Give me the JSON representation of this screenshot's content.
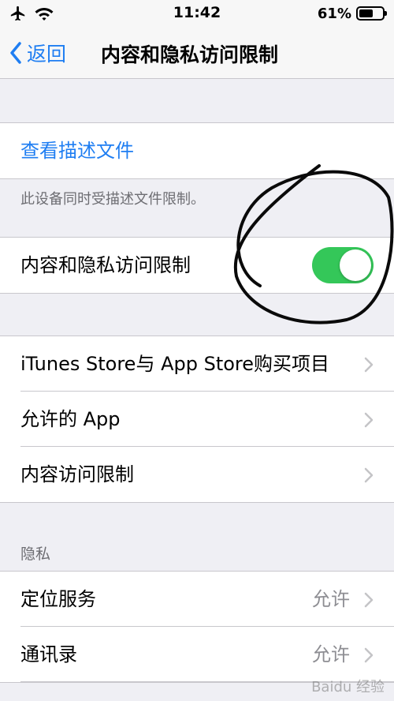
{
  "status_bar": {
    "time": "11:42",
    "battery_percent": "61%",
    "battery_level": 0.61,
    "icons": [
      "airplane-icon",
      "wifi-icon",
      "battery-icon"
    ]
  },
  "nav": {
    "back_label": "返回",
    "title": "内容和隐私访问限制"
  },
  "profile_group": {
    "link_label": "查看描述文件",
    "footnote": "此设备同时受描述文件限制。"
  },
  "main_toggle": {
    "label": "内容和隐私访问限制",
    "on": true,
    "color": "#34c759"
  },
  "restrictions_group": {
    "items": [
      {
        "label": "iTunes Store与 App Store购买项目"
      },
      {
        "label": "允许的 App"
      },
      {
        "label": "内容访问限制"
      }
    ]
  },
  "privacy": {
    "header": "隐私",
    "items": [
      {
        "label": "定位服务",
        "value": "允许"
      },
      {
        "label": "通讯录",
        "value": "允许"
      }
    ]
  },
  "watermark": "Baidu 经验",
  "colors": {
    "accent": "#1f7ef2",
    "background": "#efeff4",
    "separator": "#c8c7cc",
    "secondary_text": "#8e8e93"
  }
}
